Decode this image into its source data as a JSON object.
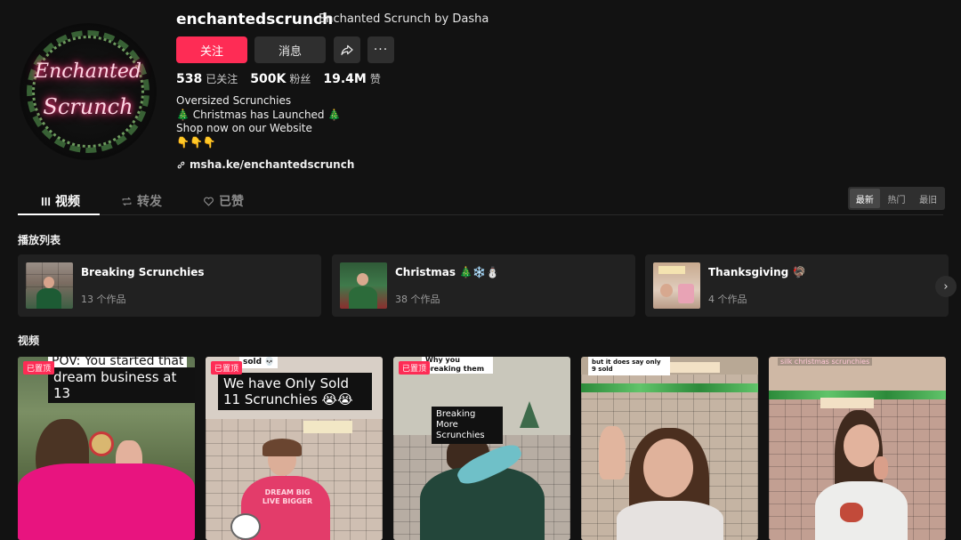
{
  "profile": {
    "username": "enchantedscrunch",
    "nickname": "Enchanted Scrunch by Dasha",
    "avatar_text_1": "Enchanted",
    "avatar_text_2": "Scrunch",
    "follow_label": "关注",
    "message_label": "消息",
    "more_label": "···",
    "stats": [
      {
        "value": "538",
        "label": "已关注"
      },
      {
        "value": "500K",
        "label": "粉丝"
      },
      {
        "value": "19.4M",
        "label": "赞"
      }
    ],
    "bio": [
      "Oversized Scrunchies",
      "🎄 Christmas has Launched 🎄",
      "Shop now on our Website",
      "👇👇👇"
    ],
    "link": "msha.ke/enchantedscrunch"
  },
  "tabs": [
    {
      "label": "视频",
      "icon": "grid-icon"
    },
    {
      "label": "转发",
      "icon": "repost-icon"
    },
    {
      "label": "已赞",
      "icon": "heart-icon"
    }
  ],
  "sort": [
    "最新",
    "热门",
    "最旧"
  ],
  "playlists_title": "播放列表",
  "playlists": [
    {
      "name": "Breaking Scrunchies",
      "count": "13 个作品"
    },
    {
      "name": "Christmas 🎄❄️⛄",
      "count": "38 个作品"
    },
    {
      "name": "Thanksgiving 🦃",
      "count": "4 个作品"
    }
  ],
  "videos_title": "视频",
  "videos": [
    {
      "pinned": "已置顶",
      "caption_top": "POV: You started that",
      "caption": "dream business at 13"
    },
    {
      "pinned": "已置顶",
      "caption_top": "sold 💀",
      "caption": "We have Only Sold 11 Scrunchies 😭😭",
      "shirt": "DREAM BIG LIVE BIGGER"
    },
    {
      "pinned": "已置顶",
      "caption_top": "Why you breaking them",
      "caption": "Breaking More Scrunchies"
    },
    {
      "comment_1": "but it does say only",
      "comment_2": "9 sold"
    },
    {
      "caption_top": "silk christmas scrunchies"
    }
  ],
  "colors": {
    "accent": "#fe2c55",
    "background": "#121212",
    "card": "#212121"
  }
}
